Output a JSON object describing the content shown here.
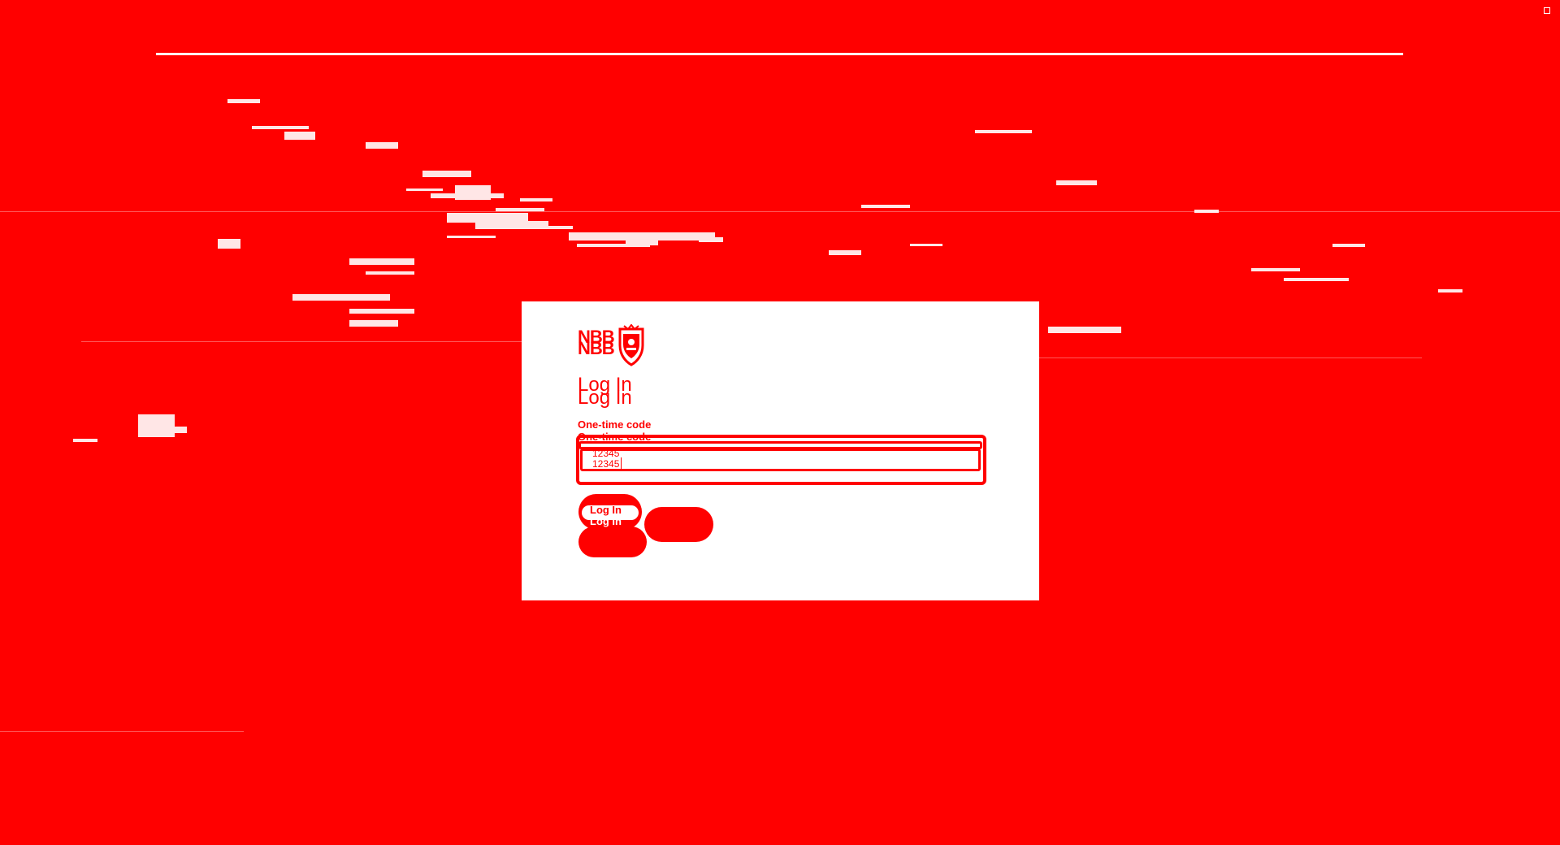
{
  "app": {
    "brand": "NBB",
    "brand_ghost": "NBB"
  },
  "login": {
    "title": "Log In",
    "title_ghost": "Log In",
    "field_label": "One-time code",
    "field_label_ghost": "One-time code",
    "code_value": "12345",
    "code_ghost": "12345",
    "login_button": "Log In",
    "login_button_ghost": "Log In",
    "cancel_button": ""
  },
  "colors": {
    "background": "#ff0000",
    "card": "#ffffff",
    "accent": "#ff0000"
  },
  "icons": {
    "crest": "crest-icon"
  }
}
